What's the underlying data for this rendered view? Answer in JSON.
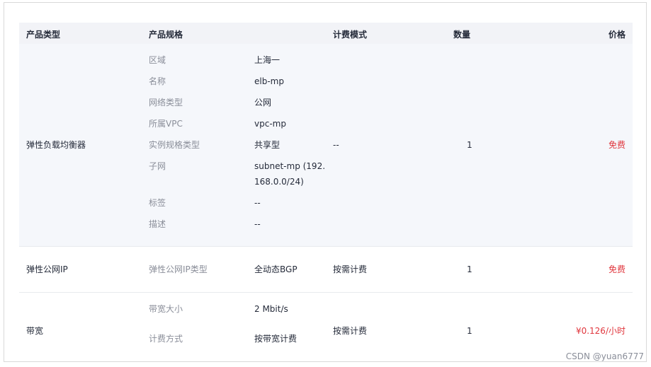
{
  "header": {
    "type": "产品类型",
    "spec": "产品规格",
    "billing": "计费模式",
    "qty": "数量",
    "price": "价格"
  },
  "elb": {
    "type": "弹性负载均衡器",
    "specs": [
      {
        "label": "区域",
        "value": "上海一"
      },
      {
        "label": "名称",
        "value": "elb-mp"
      },
      {
        "label": "网络类型",
        "value": "公网"
      },
      {
        "label": "所属VPC",
        "value": "vpc-mp"
      },
      {
        "label": "实例规格类型",
        "value": "共享型"
      },
      {
        "label": "子网",
        "value": "subnet-mp (192.",
        "value2": "168.0.0/24)"
      },
      {
        "label": "标签",
        "value": "--"
      },
      {
        "label": "描述",
        "value": "--"
      }
    ],
    "billing": "--",
    "qty": "1",
    "price": "免费"
  },
  "eip": {
    "type": "弹性公网IP",
    "spec_label": "弹性公网IP类型",
    "spec_value": "全动态BGP",
    "billing": "按需计费",
    "qty": "1",
    "price": "免费"
  },
  "bandwidth": {
    "type": "带宽",
    "specs": [
      {
        "label": "带宽大小",
        "value": "2 Mbit/s"
      },
      {
        "label": "计费方式",
        "value": "按带宽计费"
      }
    ],
    "billing": "按需计费",
    "qty": "1",
    "price": "¥0.126/小时"
  },
  "watermark": "CSDN @yuan6777",
  "colors": {
    "header_bg": "#f2f3f7",
    "row_bg": "#f5f7fb",
    "price_red": "#e0363d",
    "label_gray": "#8a8e99"
  }
}
